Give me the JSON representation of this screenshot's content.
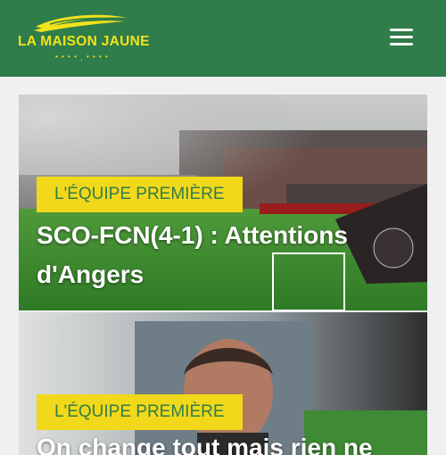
{
  "header": {
    "brand_name": "LA MAISON JAUNE",
    "brand_dots": "• • • • ¸ • • • •",
    "menu_icon": "hamburger-menu-icon",
    "background_color": "#2e7d4a",
    "brand_color": "#f3e21c"
  },
  "articles": [
    {
      "category": "L'ÉQUIPE PREMIÈRE",
      "title": "SCO-FCN(4-1) : Attentions d'Angers",
      "image": "stadium-match-photo"
    },
    {
      "category": "L'ÉQUIPE PREMIÈRE",
      "title": "On change tout mais rien ne",
      "image": "coach-portrait-photo"
    }
  ],
  "colors": {
    "badge_background": "#f2d81a",
    "badge_text": "#2e7d4a",
    "page_background": "#eef0f2"
  }
}
